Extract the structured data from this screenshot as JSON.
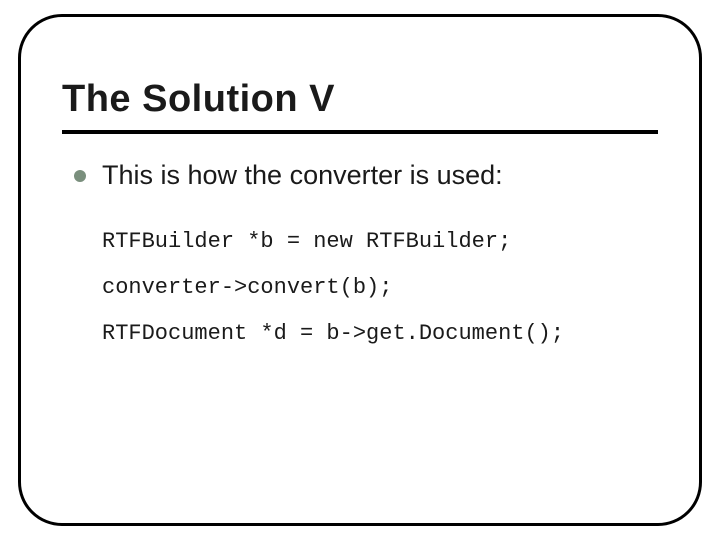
{
  "slide": {
    "title": "The Solution V",
    "bullet": "This is how the converter is used:",
    "code": {
      "line1": "RTFBuilder *b = new RTFBuilder;",
      "line2": "converter->convert(b);",
      "line3": "RTFDocument *d = b->get.Document();"
    }
  }
}
